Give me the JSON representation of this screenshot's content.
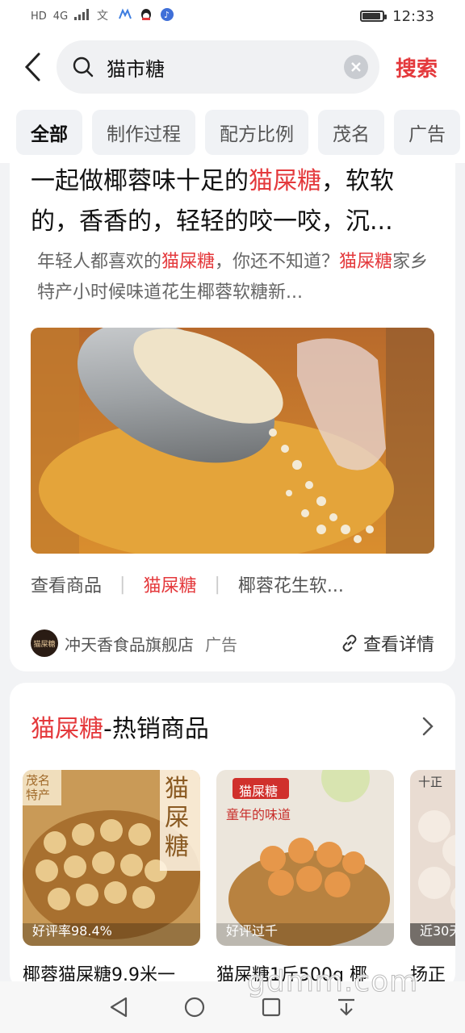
{
  "status": {
    "time": "12:33",
    "left": [
      "HD",
      "4G"
    ]
  },
  "search": {
    "query": "猫市糖",
    "submit": "搜索"
  },
  "tabs": [
    "全部",
    "制作过程",
    "配方比例",
    "茂名",
    "广告"
  ],
  "article": {
    "title_a": "一起做椰蓉味十足的",
    "title_hl": "猫屎糖",
    "title_b": "，软软的，香香的，轻轻的咬一咬，沉...",
    "desc_a": "年轻人都喜欢的",
    "desc_hl1": "猫屎糖",
    "desc_b": "，你还不知道？",
    "desc_hl2": "猫屎糖",
    "desc_c": "家乡特产小时候味道花生椰蓉软糖新...",
    "links": [
      "查看商品",
      "猫屎糖",
      "椰蓉花生软..."
    ],
    "shop_logo": "猫屎糖",
    "shop_name": "冲天香食品旗舰店",
    "ad_tag": "广告",
    "detail": "查看详情"
  },
  "hot": {
    "title_hl": "猫屎糖",
    "title_rest": "-热销商品",
    "products": [
      {
        "name": "椰蓉猫屎糖9.9米一",
        "badge": "好评率98.4%",
        "img_text_1": "茂名特产",
        "img_text_2": "猫屎糖"
      },
      {
        "name": "猫屎糖1斤500g 椰",
        "badge": "好评过千",
        "img_text_1": "猫屎糖",
        "img_text_2": "童年的味道"
      },
      {
        "name": "扬正",
        "badge": "近30天",
        "img_text_1": "十正",
        "img_text_2": ""
      }
    ]
  },
  "watermark": "gdmm.com",
  "colors": {
    "accent": "#e4393c"
  }
}
